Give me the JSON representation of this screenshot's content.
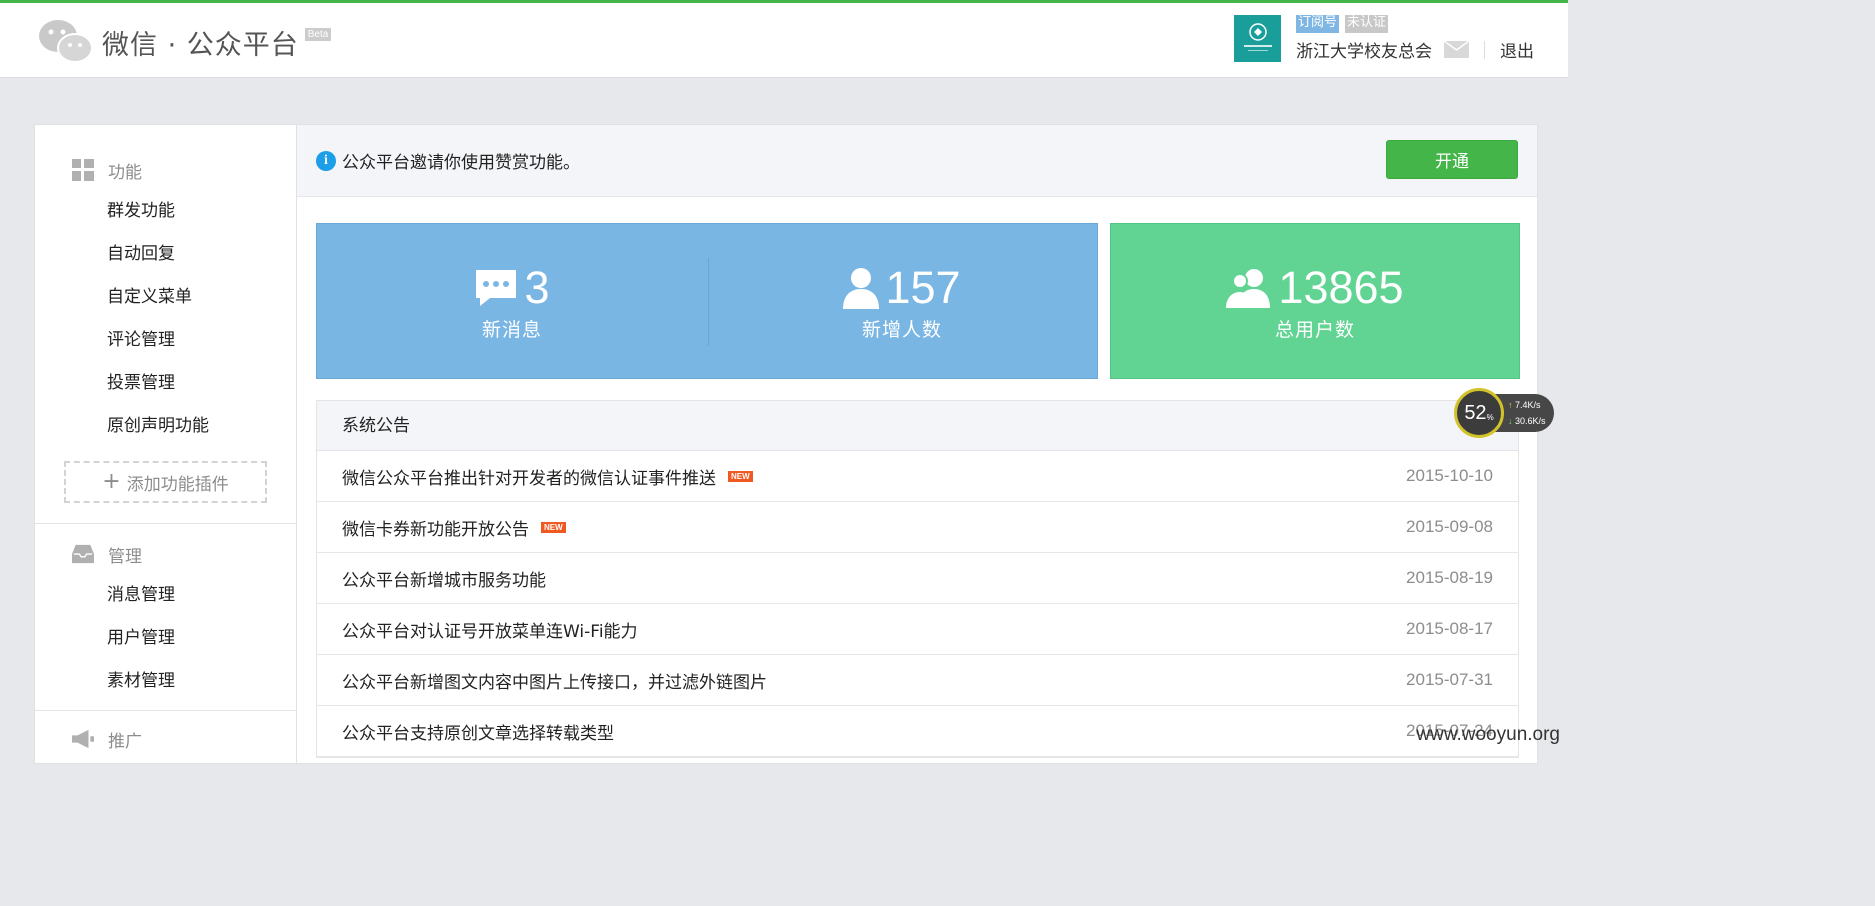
{
  "header": {
    "platform_name": "微信 · 公众平台",
    "beta": "Beta",
    "account_type": "订阅号",
    "account_status": "未认证",
    "account_name": "浙江大学校友总会",
    "logout": "退出"
  },
  "notice": {
    "text": "公众平台邀请你使用赞赏功能。",
    "button": "开通"
  },
  "stats": {
    "new_messages": {
      "value": "3",
      "label": "新消息"
    },
    "new_followers": {
      "value": "157",
      "label": "新增人数"
    },
    "total_users": {
      "value": "13865",
      "label": "总用户数"
    }
  },
  "sidebar": {
    "sections": [
      {
        "title": "功能",
        "items": [
          "群发功能",
          "自动回复",
          "自定义菜单",
          "评论管理",
          "投票管理",
          "原创声明功能"
        ]
      },
      {
        "title": "管理",
        "items": [
          "消息管理",
          "用户管理",
          "素材管理"
        ]
      },
      {
        "title": "推广",
        "items": []
      }
    ],
    "add_plugin": "添加功能插件"
  },
  "announcements": {
    "title": "系统公告",
    "new_badge": "NEW",
    "items": [
      {
        "title": "微信公众平台推出针对开发者的微信认证事件推送",
        "date": "2015-10-10",
        "new": true
      },
      {
        "title": "微信卡券新功能开放公告",
        "date": "2015-09-08",
        "new": true
      },
      {
        "title": "公众平台新增城市服务功能",
        "date": "2015-08-19",
        "new": false
      },
      {
        "title": "公众平台对认证号开放菜单连Wi-Fi能力",
        "date": "2015-08-17",
        "new": false
      },
      {
        "title": "公众平台新增图文内容中图片上传接口，并过滤外链图片",
        "date": "2015-07-31",
        "new": false
      },
      {
        "title": "公众平台支持原创文章选择转载类型",
        "date": "2015-07-24",
        "new": false
      }
    ]
  },
  "speed_widget": {
    "percent": "52",
    "unit": "%",
    "up": "7.4K/s",
    "down": "30.6K/s"
  },
  "watermark": "www.wooyun.org",
  "colors": {
    "accent_green": "#44b549",
    "stat_blue": "#7ab6e4",
    "stat_green": "#61d493"
  }
}
